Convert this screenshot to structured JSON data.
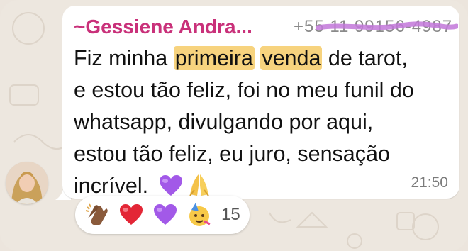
{
  "message": {
    "sender_name": "~Gessiene Andra...",
    "sender_phone": "+55 11 99156-4987",
    "lines": [
      {
        "before": "Fiz minha ",
        "hl1": "primeira",
        "mid": " ",
        "hl2": "venda",
        "after": " de tarot,"
      },
      {
        "text": "e estou tão feliz, foi no meu funil do"
      },
      {
        "text": "whatsapp, divulgando por aqui,"
      },
      {
        "text": "estou tão feliz, eu juro, sensação"
      },
      {
        "text": "incrível. "
      }
    ],
    "inline_emojis": [
      "purple-heart",
      "folded-hands"
    ],
    "time": "21:50"
  },
  "reactions": {
    "emojis": [
      "clapping-hands",
      "red-heart",
      "purple-heart",
      "partying-face"
    ],
    "count": "15"
  },
  "colors": {
    "sender": "#c9317a",
    "highlight": "#f7d37e",
    "bubble": "#ffffff",
    "background": "#ece5dd"
  }
}
